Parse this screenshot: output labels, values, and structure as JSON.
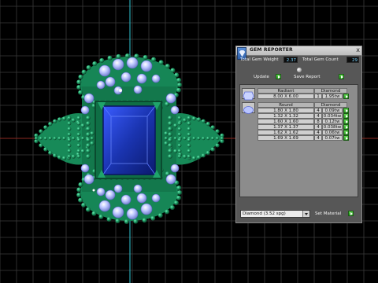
{
  "panel": {
    "title": "GEM REPORTER",
    "close": "x",
    "total_weight_label": "Total Gem Weight",
    "total_weight_value": "2.37",
    "total_count_label": "Total Gem Count",
    "total_count_value": "29",
    "update_label": "Update",
    "save_report_label": "Save Report",
    "groups": [
      {
        "cut": "Radiant",
        "material": "Diamond",
        "rows": [
          {
            "size": "8.00 X 6.00",
            "qty": "1",
            "weight": "1.95tw"
          }
        ]
      },
      {
        "cut": "Round",
        "material": "Diamond",
        "rows": [
          {
            "size": "1.80 X 1.80",
            "qty": "4",
            "weight": "0.09tw"
          },
          {
            "size": "1.32 X 1.32",
            "qty": "4",
            "weight": "0.034tw"
          },
          {
            "size": "1.60 X 1.60",
            "qty": "8",
            "weight": "0.12tw"
          },
          {
            "size": "1.37 X 1.37",
            "qty": "4",
            "weight": "0.038tw"
          },
          {
            "size": "1.62 X 1.62",
            "qty": "4",
            "weight": "0.06tw"
          },
          {
            "size": "1.69 X 1.69",
            "qty": "4",
            "weight": "0.07tw"
          }
        ]
      }
    ],
    "material_select_value": "Diamond      (3.52 spg)",
    "set_material_label": "Set Material"
  },
  "colors": {
    "metal": "#1f8f5f",
    "center_stone": "#1f3fb5",
    "side_stones": "#a9b6ff",
    "grid": "#3a3a3a",
    "axis_red": "#c0392b",
    "axis_cyan": "#35d0e0"
  }
}
